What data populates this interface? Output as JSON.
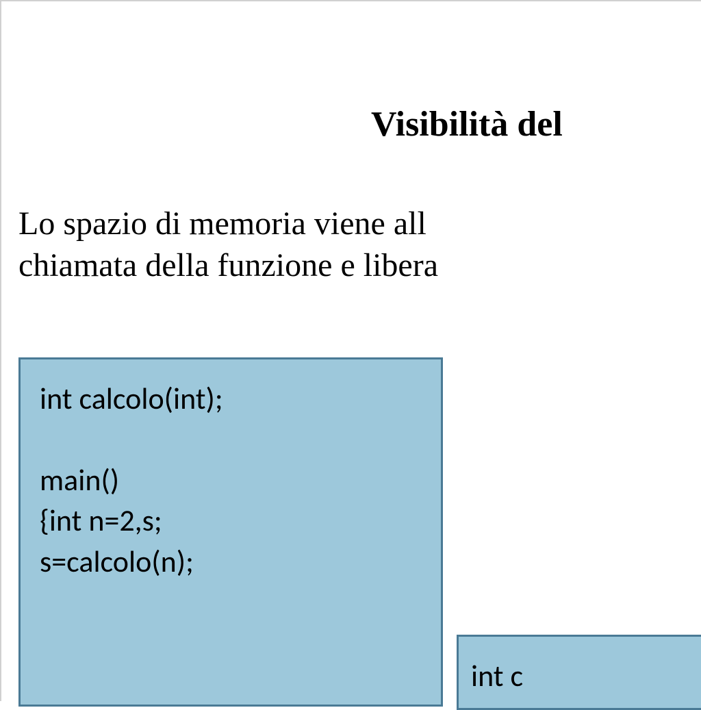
{
  "title": "Visibilità del",
  "bodyLine1": "Lo spazio di memoria viene all",
  "bodyLine2": "chiamata della funzione e libera",
  "codeBox1": {
    "line1": "int calcolo(int);",
    "line2": "main()",
    "line3": "{int n=2,s;",
    "line4": "s=calcolo(n);"
  },
  "codeBox2": {
    "line1": "int c"
  }
}
